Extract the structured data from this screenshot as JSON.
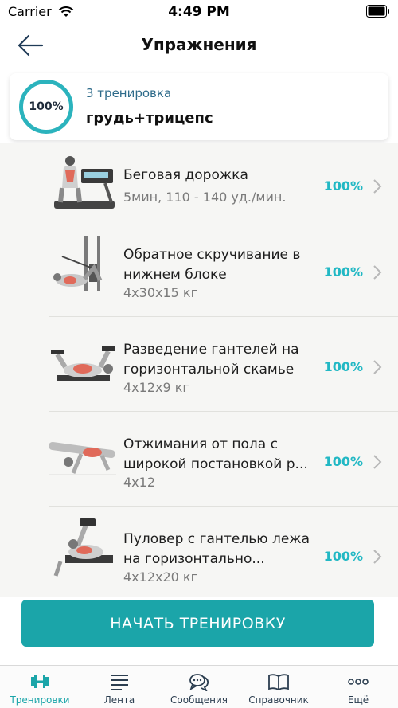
{
  "status_bar": {
    "carrier": "Carrier",
    "time": "4:49 PM"
  },
  "navbar": {
    "title": "Упражнения",
    "back_icon": "arrow-left-icon"
  },
  "summary": {
    "progress": "100%",
    "workout_number": "3 тренировка",
    "workout_name": "грудь+трицепс"
  },
  "exercises": [
    {
      "title": "Беговая дорожка",
      "details": "5мин, 110 - 140 уд./мин.",
      "progress": "100%"
    },
    {
      "title": "Обратное скручивание в нижнем блоке",
      "details": "4x30x15 кг",
      "progress": "100%"
    },
    {
      "title": "Разведение гантелей на горизонтальной скамье",
      "details": "4x12x9 кг",
      "progress": "100%"
    },
    {
      "title": "Отжимания от пола с широкой постановкой р...",
      "details": "4x12",
      "progress": "100%"
    },
    {
      "title": "Пуловер с гантелью лежа на горизонтально...",
      "details": "4x12x20 кг",
      "progress": "100%"
    }
  ],
  "start_button": "НАЧАТЬ ТРЕНИРОВКУ",
  "tabs": [
    {
      "label": "Тренировки",
      "icon": "dumbbell-icon",
      "active": true
    },
    {
      "label": "Лента",
      "icon": "feed-icon",
      "active": false
    },
    {
      "label": "Сообщения",
      "icon": "chat-icon",
      "active": false
    },
    {
      "label": "Справочник",
      "icon": "book-icon",
      "active": false
    },
    {
      "label": "Ещё",
      "icon": "more-icon",
      "active": false
    }
  ],
  "colors": {
    "accent": "#1ba5a9",
    "percent_text": "#22b8c4",
    "ring": "#2bb3bd"
  }
}
